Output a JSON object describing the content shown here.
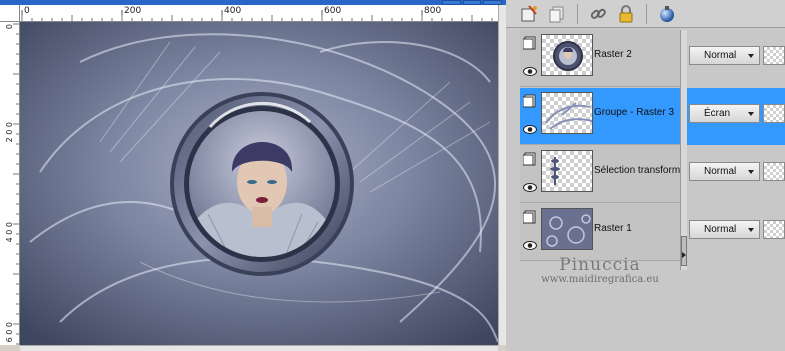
{
  "canvas": {
    "ruler_h": [
      "0",
      "200",
      "400",
      "600",
      "800"
    ],
    "ruler_v": [
      "0",
      "2 0 0",
      "4 0 0",
      "6 0 0"
    ]
  },
  "palette": {
    "toolbar_icons": [
      "new-layer-icon",
      "duplicate-layer-icon",
      "link-icon",
      "lock-icon",
      "sphere-icon"
    ],
    "layers": [
      {
        "name": "Raster 2",
        "blend": "Normal",
        "selected": false
      },
      {
        "name": "Groupe - Raster 3",
        "blend": "Écran",
        "selected": true
      },
      {
        "name": "Sélection transformée",
        "blend": "Normal",
        "selected": false
      },
      {
        "name": "Raster 1",
        "blend": "Normal",
        "selected": false
      }
    ]
  },
  "watermark": {
    "name": "Pinuccia",
    "url": "www.maidiregrafica.eu"
  },
  "colors": {
    "selection": "#3399ff",
    "titlebar": "#2a66c7",
    "artwork_base": "#5e6680"
  }
}
